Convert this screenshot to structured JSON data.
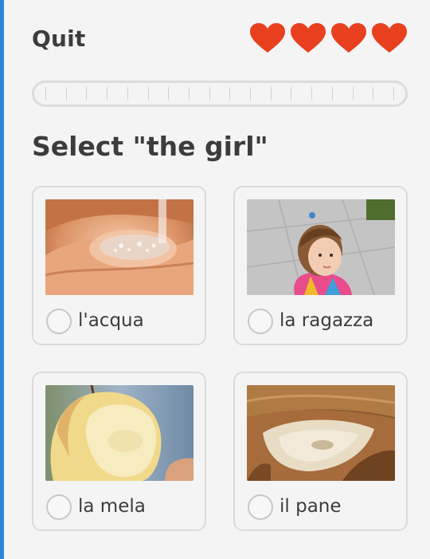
{
  "header": {
    "quit_label": "Quit",
    "hearts": 4,
    "heart_color": "#e8401f"
  },
  "progress": {
    "fraction": 0,
    "segments": 18
  },
  "prompt": {
    "text": "Select \"the girl\""
  },
  "options": [
    {
      "label": "l'acqua",
      "image": "water-photo",
      "selected": false
    },
    {
      "label": "la ragazza",
      "image": "girl-photo",
      "selected": false
    },
    {
      "label": "la mela",
      "image": "apple-photo",
      "selected": false
    },
    {
      "label": "il pane",
      "image": "bread-photo",
      "selected": false
    }
  ],
  "colors": {
    "accent_edge": "#2b86d6",
    "background": "#f4f4f4",
    "text": "#3c3c3c",
    "card_border": "#dadada"
  }
}
